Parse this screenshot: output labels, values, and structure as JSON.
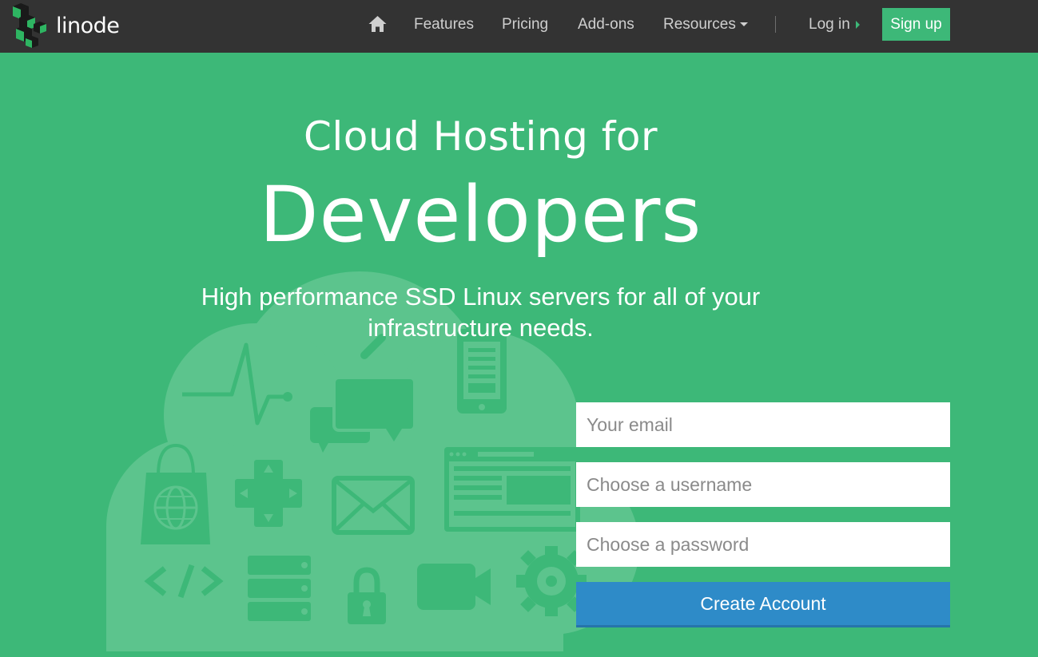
{
  "brand": {
    "name": "linode"
  },
  "nav": {
    "home_icon": "home-icon",
    "items": [
      {
        "label": "Features"
      },
      {
        "label": "Pricing"
      },
      {
        "label": "Add-ons"
      },
      {
        "label": "Resources"
      }
    ],
    "login": "Log in",
    "signup": "Sign up"
  },
  "hero": {
    "title_line1": "Cloud Hosting for",
    "title_line2": "Developers",
    "tagline": "High performance SSD Linux servers for all of your infrastructure needs."
  },
  "signup_form": {
    "email_placeholder": "Your email",
    "username_placeholder": "Choose a username",
    "password_placeholder": "Choose a password",
    "submit_label": "Create Account"
  },
  "background_icons": [
    "heartbeat-icon",
    "chat-icon",
    "mobile-icon",
    "search-icon",
    "shopping-bag-icon",
    "dpad-icon",
    "mail-icon",
    "browser-icon",
    "code-icon",
    "server-icon",
    "lock-icon",
    "video-camera-icon",
    "gear-icon"
  ],
  "colors": {
    "accent_green": "#3db878",
    "topbar": "#333333",
    "button_blue": "#2e8bc8"
  }
}
